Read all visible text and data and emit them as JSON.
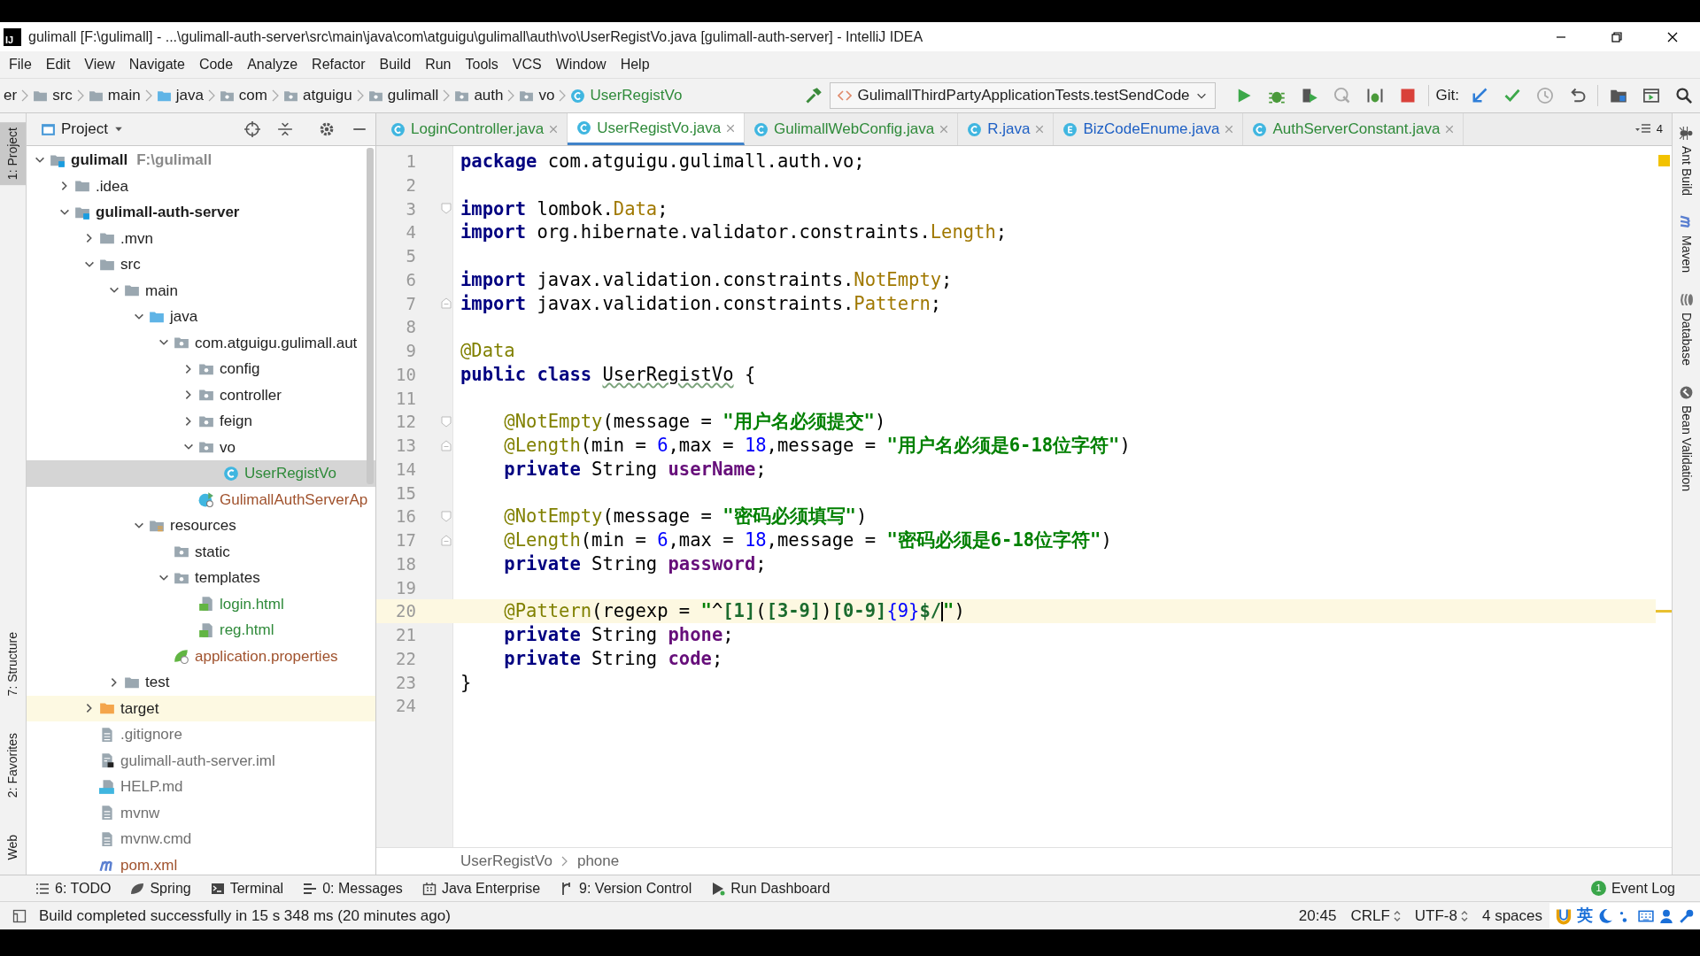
{
  "window": {
    "logo": "IJ",
    "title": "gulimall [F:\\gulimall] - ...\\gulimall-auth-server\\src\\main\\java\\com\\atguigu\\gulimall\\auth\\vo\\UserRegistVo.java [gulimall-auth-server] - IntelliJ IDEA"
  },
  "menu": [
    "File",
    "Edit",
    "View",
    "Navigate",
    "Code",
    "Analyze",
    "Refactor",
    "Build",
    "Run",
    "Tools",
    "VCS",
    "Window",
    "Help"
  ],
  "nav_crumbs": [
    {
      "label": "er",
      "kind": "none"
    },
    {
      "label": "src",
      "kind": "folder"
    },
    {
      "label": "main",
      "kind": "folder"
    },
    {
      "label": "java",
      "kind": "source"
    },
    {
      "label": "com",
      "kind": "package"
    },
    {
      "label": "atguigu",
      "kind": "package"
    },
    {
      "label": "gulimall",
      "kind": "package"
    },
    {
      "label": "auth",
      "kind": "package"
    },
    {
      "label": "vo",
      "kind": "package"
    },
    {
      "label": "UserRegistVo",
      "kind": "class",
      "color": "#2f8a3a"
    }
  ],
  "toolbar": {
    "run_config": "GulimallThirdPartyApplicationTests.testSendCode",
    "git_label": "Git:"
  },
  "left_tool_windows": [
    {
      "label": "1: Project",
      "selected": true
    },
    {
      "label": "7: Structure",
      "selected": false
    },
    {
      "label": "2: Favorites",
      "selected": false
    },
    {
      "label": "Web",
      "selected": false
    }
  ],
  "project_panel": {
    "title": "Project"
  },
  "project_tree": [
    {
      "label": "gulimall",
      "path": "F:\\gulimall",
      "kind": "module",
      "expanded": true,
      "selected": false,
      "children": [
        {
          "label": ".idea",
          "kind": "folder",
          "expanded": false,
          "selected": false
        },
        {
          "label": "gulimall-auth-server",
          "kind": "module",
          "expanded": true,
          "selected": false,
          "children": [
            {
              "label": ".mvn",
              "kind": "folder",
              "expanded": false,
              "selected": false
            },
            {
              "label": "src",
              "kind": "folder",
              "expanded": true,
              "selected": false,
              "children": [
                {
                  "label": "main",
                  "kind": "folder",
                  "expanded": true,
                  "selected": false,
                  "children": [
                    {
                      "label": "java",
                      "kind": "source",
                      "expanded": true,
                      "selected": false,
                      "children": [
                        {
                          "label": "com.atguigu.gulimall.aut",
                          "kind": "package",
                          "expanded": true,
                          "selected": false,
                          "children": [
                            {
                              "label": "config",
                              "kind": "package",
                              "expanded": false,
                              "selected": false
                            },
                            {
                              "label": "controller",
                              "kind": "package",
                              "expanded": false,
                              "selected": false
                            },
                            {
                              "label": "feign",
                              "kind": "package",
                              "expanded": false,
                              "selected": false
                            },
                            {
                              "label": "vo",
                              "kind": "package",
                              "expanded": true,
                              "selected": false,
                              "children": [
                                {
                                  "label": "UserRegistVo",
                                  "kind": "class",
                                  "color": "#2f8a3a",
                                  "selected": true
                                }
                              ]
                            },
                            {
                              "label": "GulimallAuthServerAp",
                              "kind": "spring-app",
                              "color": "#a0522d",
                              "selected": false
                            }
                          ]
                        }
                      ]
                    },
                    {
                      "label": "resources",
                      "kind": "resources",
                      "expanded": true,
                      "selected": false,
                      "children": [
                        {
                          "label": "static",
                          "kind": "package",
                          "selected": false
                        },
                        {
                          "label": "templates",
                          "kind": "package",
                          "expanded": true,
                          "selected": false,
                          "children": [
                            {
                              "label": "login.html",
                              "kind": "html",
                              "color": "#2f8a3a",
                              "selected": false
                            },
                            {
                              "label": "reg.html",
                              "kind": "html",
                              "color": "#2f8a3a",
                              "selected": false
                            }
                          ]
                        },
                        {
                          "label": "application.properties",
                          "kind": "properties",
                          "color": "#a0522d",
                          "selected": false
                        }
                      ]
                    }
                  ]
                },
                {
                  "label": "test",
                  "kind": "folder",
                  "expanded": false,
                  "selected": false
                }
              ]
            },
            {
              "label": "target",
              "kind": "excluded",
              "expanded": false,
              "selected": false
            },
            {
              "label": ".gitignore",
              "kind": "file",
              "color": "#707070",
              "selected": false
            },
            {
              "label": "gulimall-auth-server.iml",
              "kind": "iml",
              "color": "#707070",
              "selected": false
            },
            {
              "label": "HELP.md",
              "kind": "md",
              "color": "#707070",
              "selected": false
            },
            {
              "label": "mvnw",
              "kind": "file",
              "color": "#707070",
              "selected": false
            },
            {
              "label": "mvnw.cmd",
              "kind": "file",
              "color": "#707070",
              "selected": false
            },
            {
              "label": "pom.xml",
              "kind": "maven",
              "color": "#a0522d",
              "selected": false
            }
          ]
        }
      ]
    }
  ],
  "tabs": [
    {
      "label": "LoginController.java",
      "kind": "class",
      "color": "#2f8a3a",
      "selected": false
    },
    {
      "label": "UserRegistVo.java",
      "kind": "class",
      "color": "#2f8a3a",
      "selected": true
    },
    {
      "label": "GulimallWebConfig.java",
      "kind": "class",
      "color": "#2f8a3a",
      "selected": false
    },
    {
      "label": "R.java",
      "kind": "class",
      "color": "#1d5fc4",
      "selected": false
    },
    {
      "label": "BizCodeEnume.java",
      "kind": "enum",
      "color": "#1d5fc4",
      "selected": false
    },
    {
      "label": "AuthServerConstant.java",
      "kind": "class",
      "color": "#2f8a3a",
      "selected": false
    }
  ],
  "tab_overflow": "4",
  "code_lines": [
    {
      "number": "1",
      "current": false,
      "segments": [
        {
          "kind": "kw",
          "text": "package"
        },
        {
          "kind": "plain",
          "text": " com.atguigu.gulimall.auth.vo;"
        }
      ]
    },
    {
      "number": "2",
      "current": false
    },
    {
      "number": "3",
      "current": false,
      "fold_start": true,
      "segments": [
        {
          "kind": "kw",
          "text": "import"
        },
        {
          "kind": "plain",
          "text": " lombok."
        },
        {
          "kind": "cls",
          "text": "Data"
        },
        {
          "kind": "plain",
          "text": ";"
        }
      ]
    },
    {
      "number": "4",
      "current": false,
      "segments": [
        {
          "kind": "kw",
          "text": "import"
        },
        {
          "kind": "plain",
          "text": " org.hibernate.validator.constraints."
        },
        {
          "kind": "cls",
          "text": "Length"
        },
        {
          "kind": "plain",
          "text": ";"
        }
      ]
    },
    {
      "number": "5",
      "current": false
    },
    {
      "number": "6",
      "current": false,
      "segments": [
        {
          "kind": "kw",
          "text": "import"
        },
        {
          "kind": "plain",
          "text": " javax.validation.constraints."
        },
        {
          "kind": "cls",
          "text": "NotEmpty"
        },
        {
          "kind": "plain",
          "text": ";"
        }
      ]
    },
    {
      "number": "7",
      "current": false,
      "fold_end": true,
      "segments": [
        {
          "kind": "kw",
          "text": "import"
        },
        {
          "kind": "plain",
          "text": " javax.validation.constraints."
        },
        {
          "kind": "cls",
          "text": "Pattern"
        },
        {
          "kind": "plain",
          "text": ";"
        }
      ]
    },
    {
      "number": "8",
      "current": false
    },
    {
      "number": "9",
      "current": false,
      "segments": [
        {
          "kind": "ann",
          "text": "@Data"
        }
      ]
    },
    {
      "number": "10",
      "current": false,
      "segments": [
        {
          "kind": "kw",
          "text": "public class "
        },
        {
          "kind": "typo",
          "text": "UserRegistVo"
        },
        {
          "kind": "plain",
          "text": " {"
        }
      ]
    },
    {
      "number": "11",
      "current": false
    },
    {
      "number": "12",
      "current": false,
      "fold_start": true,
      "segments": [
        {
          "kind": "ann",
          "text": "    @NotEmpty"
        },
        {
          "kind": "plain",
          "text": "(message = "
        },
        {
          "kind": "str",
          "text": "\"用户名必须提交\""
        },
        {
          "kind": "plain",
          "text": ")"
        }
      ]
    },
    {
      "number": "13",
      "current": false,
      "fold_end": true,
      "segments": [
        {
          "kind": "ann",
          "text": "    @Length"
        },
        {
          "kind": "plain",
          "text": "(min = "
        },
        {
          "kind": "num",
          "text": "6"
        },
        {
          "kind": "plain",
          "text": ",max = "
        },
        {
          "kind": "num",
          "text": "18"
        },
        {
          "kind": "plain",
          "text": ",message = "
        },
        {
          "kind": "str",
          "text": "\"用户名必须是6-18位字符\""
        },
        {
          "kind": "plain",
          "text": ")"
        }
      ]
    },
    {
      "number": "14",
      "current": false,
      "segments": [
        {
          "kind": "kw",
          "text": "    private"
        },
        {
          "kind": "plain",
          "text": " String "
        },
        {
          "kind": "field",
          "text": "userName"
        },
        {
          "kind": "plain",
          "text": ";"
        }
      ]
    },
    {
      "number": "15",
      "current": false
    },
    {
      "number": "16",
      "current": false,
      "fold_start": true,
      "segments": [
        {
          "kind": "ann",
          "text": "    @NotEmpty"
        },
        {
          "kind": "plain",
          "text": "(message = "
        },
        {
          "kind": "str",
          "text": "\"密码必须填写\""
        },
        {
          "kind": "plain",
          "text": ")"
        }
      ]
    },
    {
      "number": "17",
      "current": false,
      "fold_end": true,
      "segments": [
        {
          "kind": "ann",
          "text": "    @Length"
        },
        {
          "kind": "plain",
          "text": "(min = "
        },
        {
          "kind": "num",
          "text": "6"
        },
        {
          "kind": "plain",
          "text": ",max = "
        },
        {
          "kind": "num",
          "text": "18"
        },
        {
          "kind": "plain",
          "text": ",message = "
        },
        {
          "kind": "str",
          "text": "\"密码必须是6-18位字符\""
        },
        {
          "kind": "plain",
          "text": ")"
        }
      ]
    },
    {
      "number": "18",
      "current": false,
      "segments": [
        {
          "kind": "kw",
          "text": "    private"
        },
        {
          "kind": "plain",
          "text": " String "
        },
        {
          "kind": "field",
          "text": "password"
        },
        {
          "kind": "plain",
          "text": ";"
        }
      ]
    },
    {
      "number": "19",
      "current": false
    },
    {
      "number": "20",
      "current": true,
      "segments": [
        {
          "kind": "ann",
          "text": "    @Pattern"
        },
        {
          "kind": "plain",
          "text": "(regexp = "
        },
        {
          "kind": "str",
          "text": "\""
        },
        {
          "kind": "plain",
          "text": "^"
        },
        {
          "kind": "rx",
          "text": "[1]"
        },
        {
          "kind": "plain",
          "text": "("
        },
        {
          "kind": "rx",
          "text": "[3-9]"
        },
        {
          "kind": "plain",
          "text": ")"
        },
        {
          "kind": "rx",
          "text": "[0-9]"
        },
        {
          "kind": "num",
          "text": "{9}"
        },
        {
          "kind": "rx",
          "text": "$/"
        },
        {
          "kind": "caret"
        },
        {
          "kind": "str",
          "text": "\""
        },
        {
          "kind": "plain",
          "text": ")"
        }
      ]
    },
    {
      "number": "21",
      "current": false,
      "segments": [
        {
          "kind": "kw",
          "text": "    private"
        },
        {
          "kind": "plain",
          "text": " String "
        },
        {
          "kind": "field",
          "text": "phone"
        },
        {
          "kind": "plain",
          "text": ";"
        }
      ]
    },
    {
      "number": "22",
      "current": false,
      "segments": [
        {
          "kind": "kw",
          "text": "    private"
        },
        {
          "kind": "plain",
          "text": " String "
        },
        {
          "kind": "field",
          "text": "code"
        },
        {
          "kind": "plain",
          "text": ";"
        }
      ]
    },
    {
      "number": "23",
      "current": false,
      "segments": [
        {
          "kind": "plain",
          "text": "}"
        }
      ]
    },
    {
      "number": "24",
      "current": false
    }
  ],
  "editor_breadcrumbs": [
    "UserRegistVo",
    "phone"
  ],
  "right_tool_windows": [
    {
      "label": "Ant Build",
      "kind": "ant"
    },
    {
      "label": "Maven",
      "kind": "maven"
    },
    {
      "label": "Database",
      "kind": "database"
    },
    {
      "label": "Bean Validation",
      "kind": "bean"
    }
  ],
  "bottom_tool_windows": [
    {
      "label": "6: TODO",
      "kind": "list"
    },
    {
      "label": "Spring",
      "kind": "leaf"
    },
    {
      "label": "Terminal",
      "kind": "terminal"
    },
    {
      "label": "0: Messages",
      "kind": "messages"
    },
    {
      "label": "Java Enterprise",
      "kind": "enterprise"
    },
    {
      "label": "9: Version Control",
      "kind": "vcs"
    },
    {
      "label": "Run Dashboard",
      "kind": "run"
    }
  ],
  "event_log": {
    "label": "Event Log",
    "badge": "1"
  },
  "status_bar": {
    "message": "Build completed successfully in 15 s 348 ms (20 minutes ago)",
    "widgets": [
      {
        "label": "20:45",
        "dropdown": false
      },
      {
        "label": "CRLF",
        "dropdown": true
      },
      {
        "label": "UTF-8",
        "dropdown": true
      },
      {
        "label": "4 spaces",
        "dropdown": false
      }
    ],
    "ime_mode": "英"
  }
}
